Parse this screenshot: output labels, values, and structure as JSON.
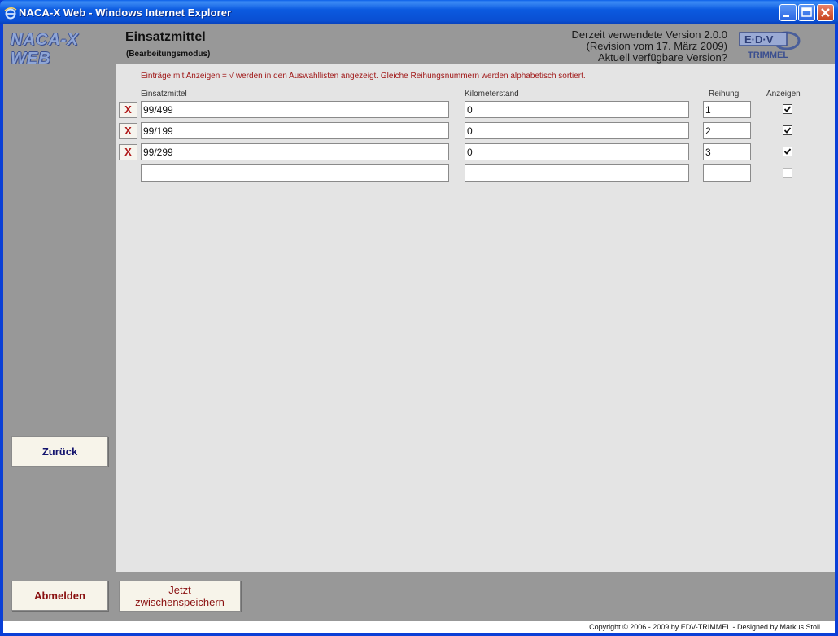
{
  "window": {
    "title": "NACA-X Web - Windows Internet Explorer"
  },
  "header": {
    "logo_text": "NACA-X WEB",
    "page_title": "Einsatzmittel",
    "page_subtitle": "(Bearbeitungsmodus)",
    "version_line1": "Derzeit verwendete Version 2.0.0",
    "version_line2": "(Revision vom 17. März 2009)",
    "version_line3": "Aktuell verfügbare Version?",
    "edv_logo_top": "E·D·V",
    "edv_logo_bottom": "TRIMMEL"
  },
  "content": {
    "hint": "Einträge mit Anzeigen = √ werden in den Auswahllisten angezeigt. Gleiche Reihungsnummern werden alphabetisch sortiert.",
    "columns": {
      "einsatzmittel": "Einsatzmittel",
      "kilometerstand": "Kilometerstand",
      "reihung": "Reihung",
      "anzeigen": "Anzeigen"
    },
    "delete_label": "X",
    "rows": [
      {
        "einsatzmittel": "99/499",
        "kilometerstand": "0",
        "reihung": "1",
        "anzeigen": true
      },
      {
        "einsatzmittel": "99/199",
        "kilometerstand": "0",
        "reihung": "2",
        "anzeigen": true
      },
      {
        "einsatzmittel": "99/299",
        "kilometerstand": "0",
        "reihung": "3",
        "anzeigen": true
      },
      {
        "einsatzmittel": "",
        "kilometerstand": "",
        "reihung": "",
        "anzeigen": false
      }
    ]
  },
  "sidebar": {
    "back_label": "Zurück",
    "logout_label": "Abmelden",
    "save_line1": "Jetzt",
    "save_line2": "zwischenspeichern"
  },
  "footer": {
    "copyright": "Copyright © 2006 - 2009 by EDV-TRIMMEL - Designed by Markus Stoll"
  },
  "colors": {
    "titlebar": "#0a5fe8",
    "client_bg": "#989898",
    "content_bg": "#e4e4e4",
    "hint_text": "#a01818",
    "delete_text": "#b01818"
  }
}
